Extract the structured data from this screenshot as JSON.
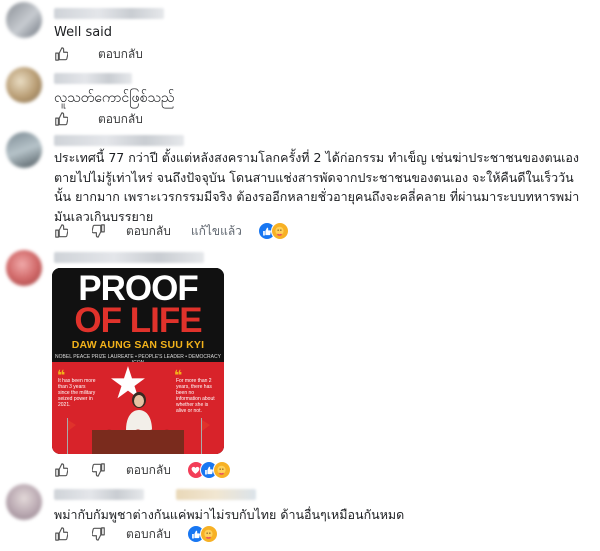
{
  "labels": {
    "reply": "ตอบกลับ",
    "edited": "แก้ไขแล้ว"
  },
  "comments": [
    {
      "text": "Well said"
    },
    {
      "text": "လူသတ်ကောင်ဖြစ်သည်"
    },
    {
      "text_lines": [
        "ประเทศนี้ 77 กว่าปี ตั้งแต่หลังสงครามโลกครั้งที่ 2 ได้ก่อกรรม ทำเข็ญ เช่นฆ่าประชาชนของตนเอง",
        "ตายไปไม่รู้เท่าไหร่ จนถึงปัจจุบัน โดนสาบแช่งสารพัดจากประชาชนของตนเอง จะให้คืนดีในเร็ววัน",
        "นั้น ยากมาก เพราะเวรกรรมมีจริง ต้องรออีกหลายชั่วอายุคนถึงจะคลี่คลาย ที่ผ่านมาระบบทหารพม่า",
        "มันเลวเกินบรรยาย"
      ]
    },
    {
      "poster": {
        "line1": "PROOF",
        "line2": "OF LIFE",
        "name": "DAW AUNG SAN SUU KYI",
        "subtitle": "NOBEL PEACE PRIZE LAUREATE • PEOPLE'S LEADER • DEMOCRACY ICON",
        "left_note": "It has been more than 3 years since the military seized power in 2021.",
        "right_note": "For more than 2 years, there has been no information about whether she is alive or not."
      }
    },
    {
      "text": "พม่ากับกัมพูชาต่างกันแค่พม่าไม่รบกับไทย ด้านอื่นๆเหมือนกันหมด"
    }
  ],
  "colors": {
    "like": "#1877f2",
    "care": "#f7b125",
    "love": "#f33e58",
    "poster_red": "#d8232a",
    "poster_gold": "#f2b21b"
  },
  "icons": [
    "thumbs-up-icon",
    "thumbs-down-icon",
    "like-reaction-icon",
    "care-reaction-icon",
    "love-reaction-icon"
  ]
}
